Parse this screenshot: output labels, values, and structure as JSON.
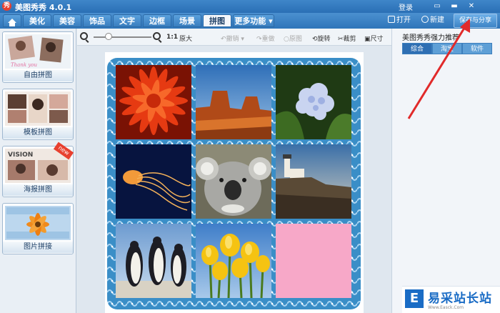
{
  "window": {
    "title": "美图秀秀 4.0.1",
    "logo_glyph": "秀",
    "login": "登录",
    "controls": [
      "▭",
      "▬",
      "✕"
    ]
  },
  "tabs": {
    "home_icon": "home-icon",
    "items": [
      "美化",
      "美容",
      "饰品",
      "文字",
      "边框",
      "场景",
      "拼图",
      "更多功能 ▾"
    ],
    "active": "拼图"
  },
  "toolbar": {
    "open_label": "打开",
    "new_label": "新建",
    "save_label": "保存与分享"
  },
  "left_panel": {
    "items": [
      {
        "label": "自由拼图"
      },
      {
        "label": "模板拼图"
      },
      {
        "label": "海报拼图",
        "thumb_text": "VISION",
        "badge": "new"
      },
      {
        "label": "图片拼接"
      }
    ],
    "free_thumb_text": "Thank you"
  },
  "canvas_toolbar": {
    "ratio_label": "1:1",
    "original_label": "原大",
    "undo_label": "撤销",
    "redo_label": "重做",
    "reset_label": "原图",
    "rotate_label": "旋转",
    "crop_label": "裁剪",
    "size_label": "尺寸"
  },
  "right_panel": {
    "title": "美图秀秀强力推荐",
    "tabs": [
      "综合",
      "淘宝",
      "软件"
    ],
    "active_tab": "综合"
  },
  "collage": {
    "border_color": "#3a8ec7",
    "cells": [
      {
        "name": "red-flower"
      },
      {
        "name": "desert-canyon"
      },
      {
        "name": "hydrangea"
      },
      {
        "name": "jellyfish"
      },
      {
        "name": "koala"
      },
      {
        "name": "lighthouse"
      },
      {
        "name": "penguins"
      },
      {
        "name": "tulips"
      },
      {
        "name": "pink-empty-slot"
      }
    ]
  },
  "annotation": {
    "arrow_color": "#e12a2a"
  },
  "watermark": {
    "glyph": "E",
    "text": "易采站长站",
    "url": "Www.Easck.Com"
  },
  "colors": {
    "accent": "#2f75b9",
    "pink_slot": "#f7a8c8"
  }
}
